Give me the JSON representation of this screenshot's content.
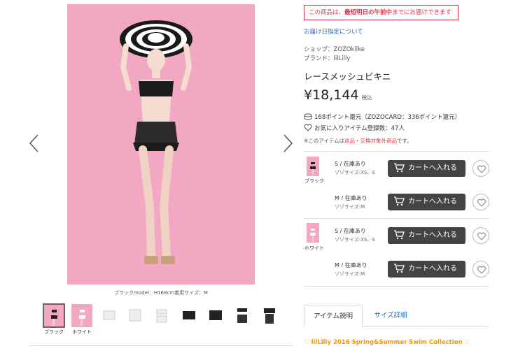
{
  "gallery": {
    "caption": "ブラックmodel：H168cm着用サイズ：M",
    "prev_icon": "chevron-left-icon",
    "next_icon": "chevron-right-icon",
    "thumbnails": [
      {
        "label": "ブラック",
        "variant": "model-black",
        "active": true
      },
      {
        "label": "ホワイト",
        "variant": "model-white",
        "active": false
      },
      {
        "label": "",
        "variant": "white-top",
        "active": false
      },
      {
        "label": "",
        "variant": "white-bottom",
        "active": false
      },
      {
        "label": "",
        "variant": "white-top-2",
        "active": false
      },
      {
        "label": "",
        "variant": "black-bottom",
        "active": false
      },
      {
        "label": "",
        "variant": "black-top",
        "active": false
      },
      {
        "label": "",
        "variant": "black-set",
        "active": false
      },
      {
        "label": "",
        "variant": "black-bottom-2",
        "active": false
      }
    ]
  },
  "notice": {
    "prefix": "この商品は、",
    "emphasis": "最短明日の午前中",
    "suffix": "までにお届けできます"
  },
  "delivery_link": "お届け日指定について",
  "shop": "ショップ：ZOZOkilke",
  "brand": "ブランド：lilLilly",
  "product_name": "レースメッシュビキニ",
  "price": {
    "amount": "¥18,144",
    "tax_label": "税込"
  },
  "points_text": "168ポイント還元（ZOZOCARD：336ポイント還元）",
  "favorites_text": "お気に入りアイテム登録数：47人",
  "return_note": {
    "prefix": "※このアイテムは",
    "emphasis": "返品・交換対象外商品",
    "suffix": "です。"
  },
  "colors": [
    {
      "name": "ブラック",
      "skus": [
        {
          "size": "S / 在庫あり",
          "sub": "ゾゾサイズ:XS、S"
        },
        {
          "size": "M / 在庫あり",
          "sub": "ゾゾサイズ:M"
        }
      ]
    },
    {
      "name": "ホワイト",
      "skus": [
        {
          "size": "S / 在庫あり",
          "sub": "ゾゾサイズ:XS、S"
        },
        {
          "size": "M / 在庫あり",
          "sub": "ゾゾサイズ:M"
        }
      ]
    }
  ],
  "cart_label": "カートへ入れる",
  "tabs": [
    {
      "label": "アイテム説明",
      "active": true
    },
    {
      "label": "サイズ詳細",
      "active": false
    }
  ],
  "collection_title": "♡ lilLilly 2016 Spring&Summer Swim Collection ♡",
  "colors_theme": {
    "accent_red": "#d5364a",
    "link_blue": "#2a6fb7",
    "cart_button": "#444444",
    "collection_orange": "#f39800",
    "photo_pink": "#f2a7c3"
  }
}
